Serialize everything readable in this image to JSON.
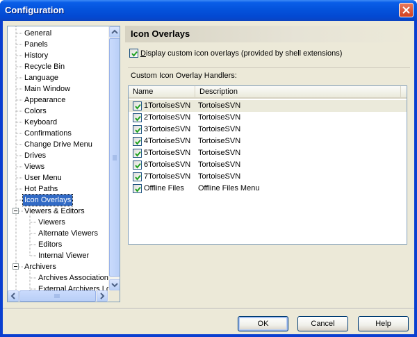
{
  "window": {
    "title": "Configuration"
  },
  "tree": {
    "items": [
      {
        "label": "General",
        "level": 1
      },
      {
        "label": "Panels",
        "level": 1
      },
      {
        "label": "History",
        "level": 1
      },
      {
        "label": "Recycle Bin",
        "level": 1
      },
      {
        "label": "Language",
        "level": 1
      },
      {
        "label": "Main Window",
        "level": 1
      },
      {
        "label": "Appearance",
        "level": 1
      },
      {
        "label": "Colors",
        "level": 1
      },
      {
        "label": "Keyboard",
        "level": 1
      },
      {
        "label": "Confirmations",
        "level": 1
      },
      {
        "label": "Change Drive Menu",
        "level": 1
      },
      {
        "label": "Drives",
        "level": 1
      },
      {
        "label": "Views",
        "level": 1
      },
      {
        "label": "User Menu",
        "level": 1
      },
      {
        "label": "Hot Paths",
        "level": 1
      },
      {
        "label": "Icon Overlays",
        "level": 1,
        "selected": true
      },
      {
        "label": "Viewers & Editors",
        "level": 1,
        "expandable": true
      },
      {
        "label": "Viewers",
        "level": 2
      },
      {
        "label": "Alternate Viewers",
        "level": 2
      },
      {
        "label": "Editors",
        "level": 2
      },
      {
        "label": "Internal Viewer",
        "level": 2
      },
      {
        "label": "Archivers",
        "level": 1,
        "expandable": true
      },
      {
        "label": "Archives Associations",
        "level": 2
      },
      {
        "label": "External Archivers Lo",
        "level": 2
      }
    ]
  },
  "panel": {
    "title": "Icon Overlays",
    "display_option": {
      "label_underlined": "D",
      "label_rest": "isplay custom icon overlays (provided by shell extensions)",
      "checked": true
    },
    "group_label": "Custom Icon Overlay Handlers:",
    "columns": [
      "Name",
      "Description"
    ],
    "rows": [
      {
        "name": "1TortoiseSVN",
        "description": "TortoiseSVN",
        "checked": true,
        "selected": true
      },
      {
        "name": "2TortoiseSVN",
        "description": "TortoiseSVN",
        "checked": true
      },
      {
        "name": "3TortoiseSVN",
        "description": "TortoiseSVN",
        "checked": true
      },
      {
        "name": "4TortoiseSVN",
        "description": "TortoiseSVN",
        "checked": true
      },
      {
        "name": "5TortoiseSVN",
        "description": "TortoiseSVN",
        "checked": true
      },
      {
        "name": "6TortoiseSVN",
        "description": "TortoiseSVN",
        "checked": true
      },
      {
        "name": "7TortoiseSVN",
        "description": "TortoiseSVN",
        "checked": true
      },
      {
        "name": "Offline Files",
        "description": "Offline Files Menu",
        "checked": true
      }
    ]
  },
  "buttons": {
    "ok": "OK",
    "cancel": "Cancel",
    "help": "Help"
  },
  "colors": {
    "title_bar": "#0453dc",
    "selection": "#316ac5",
    "dialog_bg": "#ece9d8",
    "checkmark": "#21a121"
  }
}
